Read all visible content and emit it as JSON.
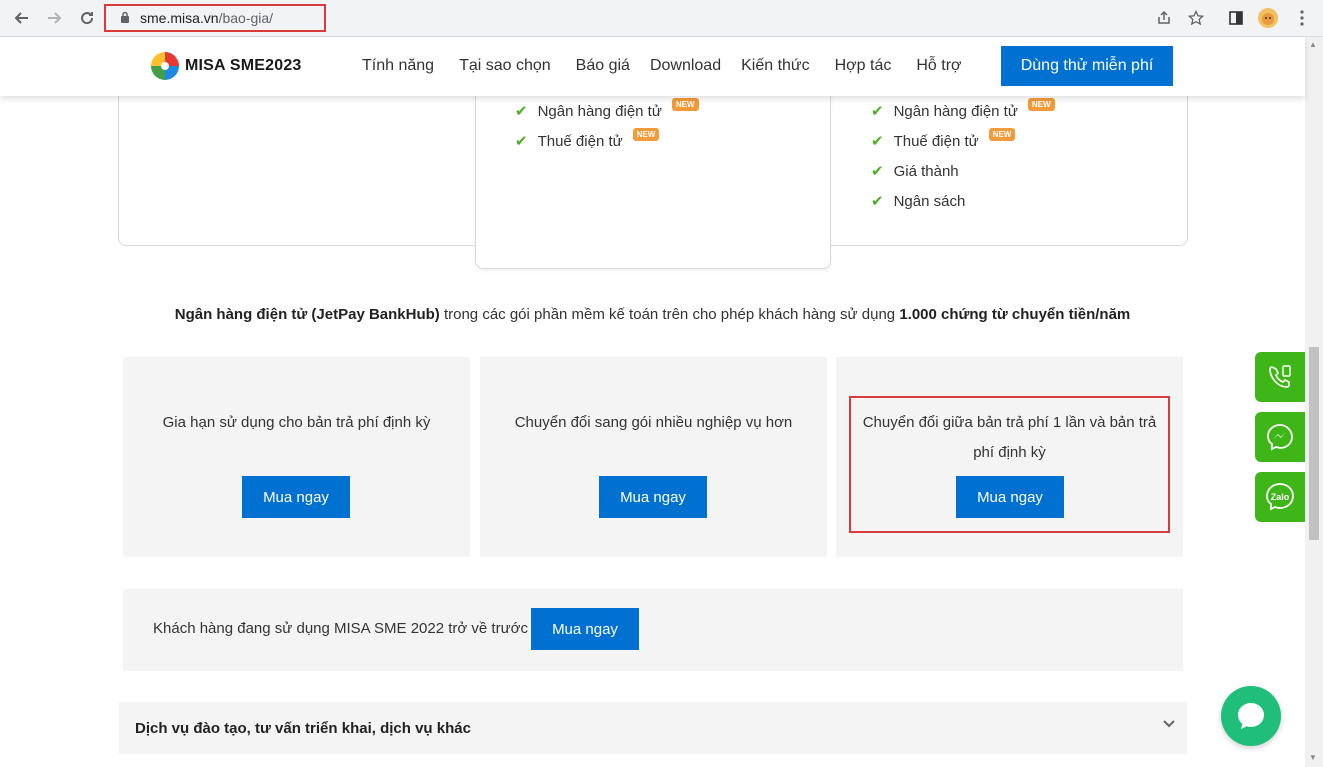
{
  "browser": {
    "url_host": "sme.misa.vn",
    "url_path": "/bao-gia/"
  },
  "header": {
    "logo_text": "MISA SME2023",
    "menu": [
      "Tính năng",
      "Tại sao chọn",
      "Báo giá",
      "Download",
      "Kiến thức",
      "Hợp tác",
      "Hỗ trợ"
    ],
    "trial_button": "Dùng thử miễn phí"
  },
  "pricing": {
    "middle_features": [
      {
        "label": "Ngân hàng điện tử",
        "badge": "NEW"
      },
      {
        "label": "Thuế điện tử",
        "badge": "NEW"
      }
    ],
    "right_features": [
      {
        "label": "Ngân hàng điện tử",
        "badge": "NEW"
      },
      {
        "label": "Thuế điện tử",
        "badge": "NEW"
      },
      {
        "label": "Giá thành",
        "badge": ""
      },
      {
        "label": "Ngân sách",
        "badge": ""
      }
    ]
  },
  "bank_note": {
    "bold_start": "Ngân hàng điện tử (JetPay BankHub)",
    "middle": " trong các gói phần mềm kế toán trên cho phép khách hàng sử dụng ",
    "bold_end": "1.000 chứng từ chuyển tiền/năm"
  },
  "cards": [
    {
      "text": "Gia hạn sử dụng cho bản trả phí định kỳ",
      "button": "Mua ngay"
    },
    {
      "text": "Chuyển đổi sang gói nhiều nghiệp vụ hơn",
      "button": "Mua ngay"
    },
    {
      "text_line1": "Chuyển đổi giữa bản trả phí 1 lần và bản trả",
      "text_line2": "phí định kỳ",
      "button": "Mua ngay"
    }
  ],
  "old_customers": {
    "text": "Khách hàng đang sử dụng MISA SME 2022 trở về trước",
    "button": "Mua ngay"
  },
  "services": {
    "title": "Dịch vụ đào tạo, tư vấn triển khai, dịch vụ khác"
  },
  "widgets": {
    "zalo_label": "Zalo"
  },
  "colors": {
    "primary": "#0070d1",
    "check": "#4caf22",
    "badge": "#f29b3a",
    "widget_green": "#3fb618",
    "highlight_red": "#d93a3a"
  }
}
